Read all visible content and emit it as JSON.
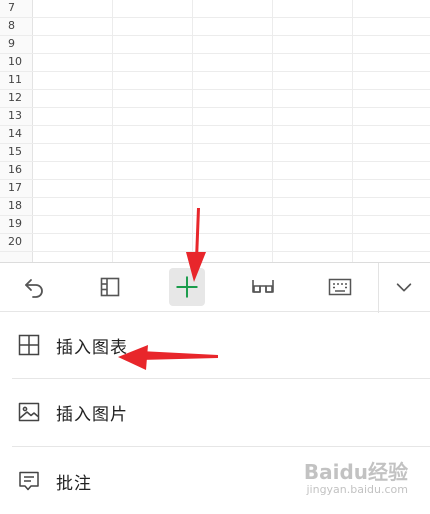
{
  "grid": {
    "row_numbers": [
      "7",
      "8",
      "9",
      "10",
      "11",
      "12",
      "13",
      "14",
      "15",
      "16",
      "17",
      "18",
      "19",
      "20"
    ]
  },
  "toolbar": {
    "buttons": [
      {
        "name": "undo",
        "icon": "undo-icon"
      },
      {
        "name": "freeze-panes",
        "icon": "panel-icon"
      },
      {
        "name": "insert",
        "icon": "plus-icon",
        "active": true,
        "color": "#1a9c4b"
      },
      {
        "name": "view",
        "icon": "glasses-icon"
      },
      {
        "name": "keyboard",
        "icon": "keyboard-icon"
      },
      {
        "name": "collapse",
        "icon": "chevron-down-icon"
      }
    ]
  },
  "menu": {
    "items": [
      {
        "label": "插入图表",
        "icon": "table-chart-icon"
      },
      {
        "label": "插入图片",
        "icon": "image-icon"
      },
      {
        "label": "批注",
        "icon": "comment-icon"
      }
    ]
  },
  "annotations": {
    "arrow_color": "#e8262b"
  },
  "watermark": {
    "text": "Baidu经验",
    "sub": "jingyan.baidu.com"
  }
}
